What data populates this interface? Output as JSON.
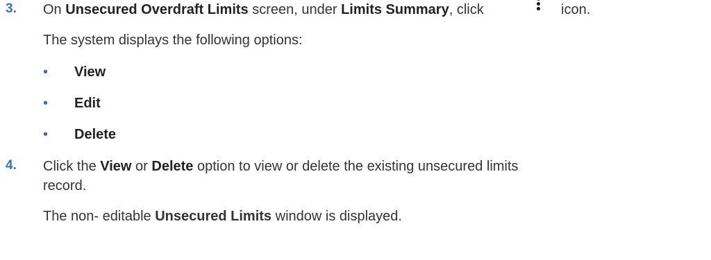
{
  "step3": {
    "number": "3.",
    "text_on": "On ",
    "screen_name": "Unsecured Overdraft Limits",
    "text_screen_under": " screen, under ",
    "section_name": "Limits Summary",
    "text_click": ", click",
    "text_icon": "icon.",
    "icon": "kebab-menu-icon",
    "result_text": "The system displays the following options:",
    "options": [
      "View",
      "Edit",
      "Delete"
    ]
  },
  "step4": {
    "number": "4.",
    "text_click_the": "Click the ",
    "option_view": "View",
    "text_or": " or ",
    "option_delete": "Delete",
    "text_rest_line1": " option to view or delete the existing unsecured limits",
    "text_line2": "record.",
    "result_prefix": "The non- editable ",
    "window_name": "Unsecured Limits",
    "result_suffix": " window is displayed."
  },
  "colors": {
    "accent": "#3a73b3",
    "text": "#333333"
  }
}
